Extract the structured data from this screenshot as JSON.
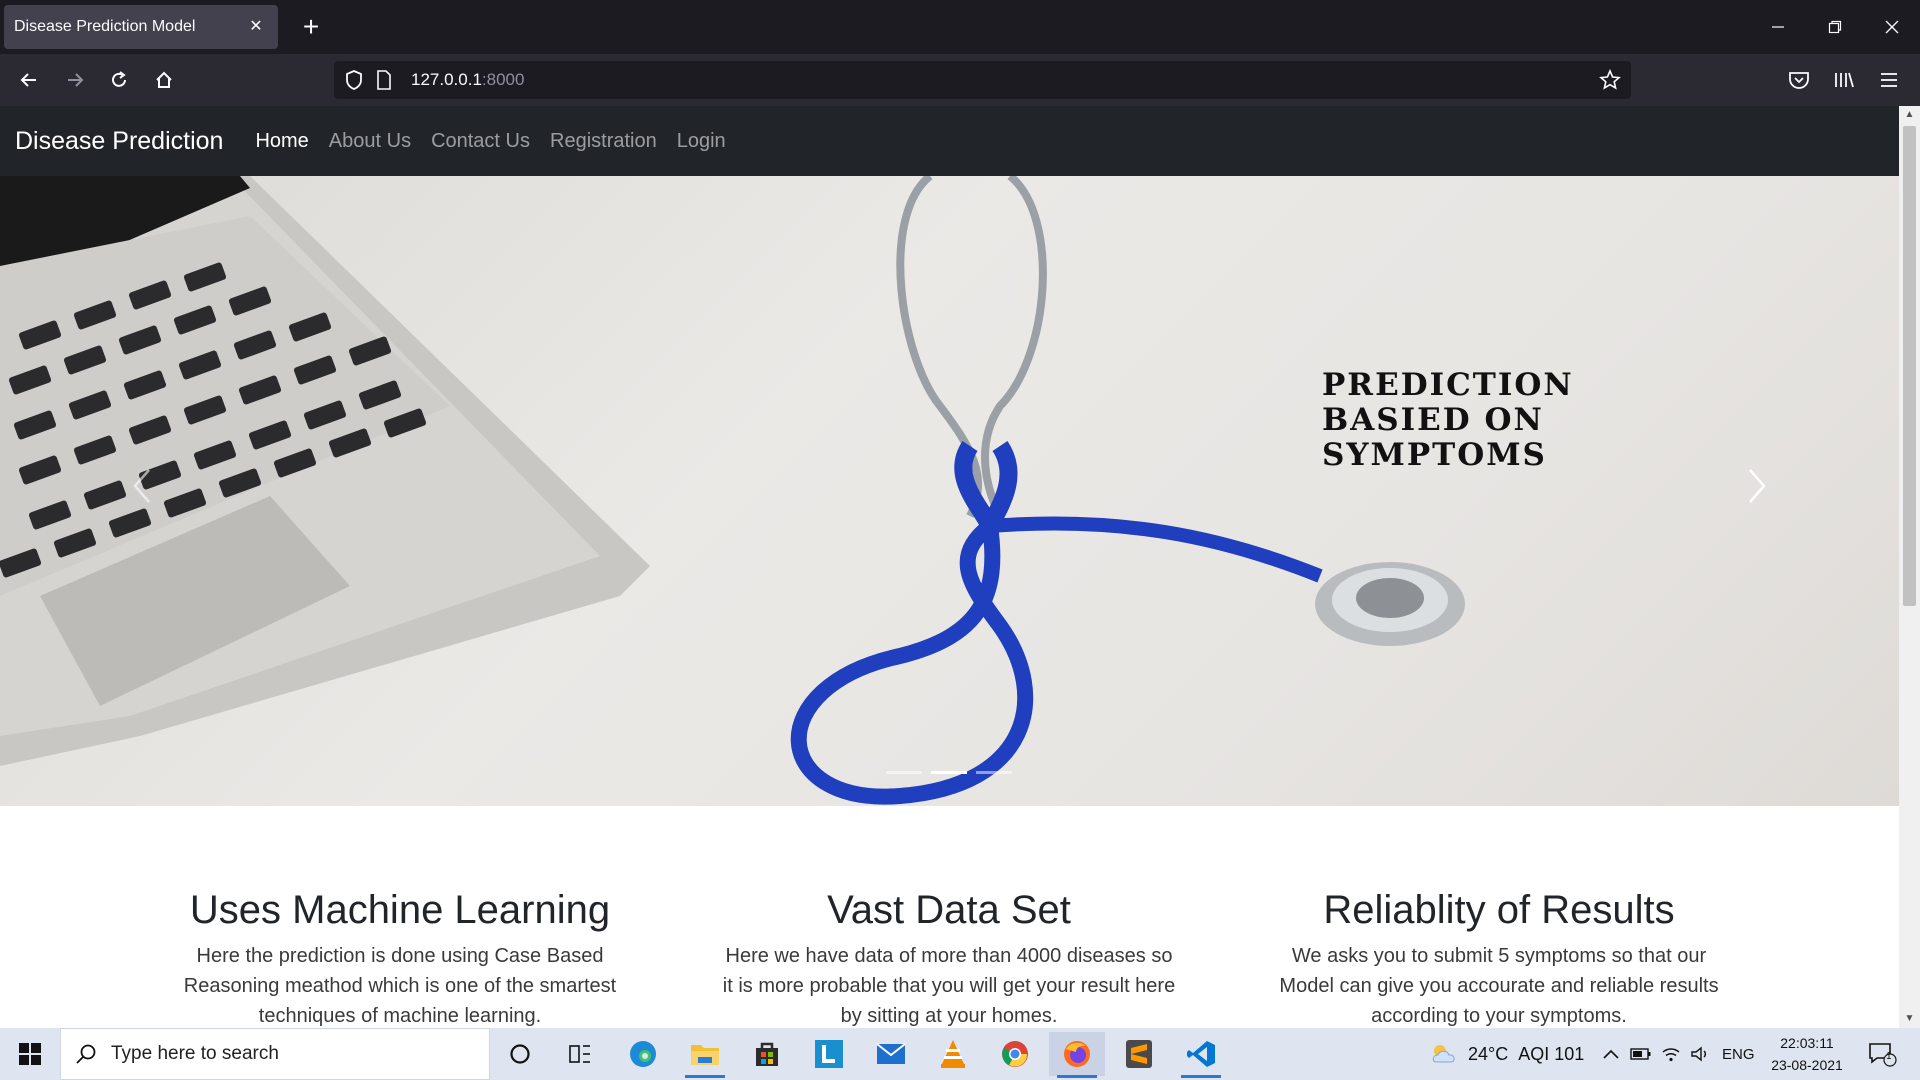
{
  "browser": {
    "tab_title": "Disease Prediction Model",
    "url_host": "127.0.0.1",
    "url_port": ":8000"
  },
  "site": {
    "brand": "Disease Prediction",
    "nav": [
      {
        "label": "Home",
        "active": true
      },
      {
        "label": "About Us",
        "active": false
      },
      {
        "label": "Contact Us",
        "active": false
      },
      {
        "label": "Registration",
        "active": false
      },
      {
        "label": "Login",
        "active": false
      }
    ]
  },
  "hero": {
    "caption_lines": [
      "PREDICTION",
      "BASIED ON",
      "SYMPTOMS"
    ],
    "slides": 3,
    "active_slide": 2
  },
  "features": [
    {
      "title": "Uses Machine Learning",
      "text": "Here the prediction is done using Case Based Reasoning meathod which is one of the smartest techniques of machine learning."
    },
    {
      "title": "Vast Data Set",
      "text": "Here we have data of more than 4000 diseases so it is more probable that you will get your result here by sitting at your homes."
    },
    {
      "title": "Reliablity of Results",
      "text": "We asks you to submit 5 symptoms so that our Model can give you accourate and reliable results according to your symptoms."
    }
  ],
  "taskbar": {
    "search_placeholder": "Type here to search",
    "weather": "24°C",
    "aqi": "AQI 101",
    "lang": "ENG",
    "time": "22:03:11",
    "date": "23-08-2021",
    "notification_count": "1"
  },
  "colors": {
    "site_nav_bg": "#212529",
    "browser_bg": "#1c1b22",
    "stethoscope_blue": "#1f3fbf",
    "taskbar_bg": "#dfe5f0"
  }
}
